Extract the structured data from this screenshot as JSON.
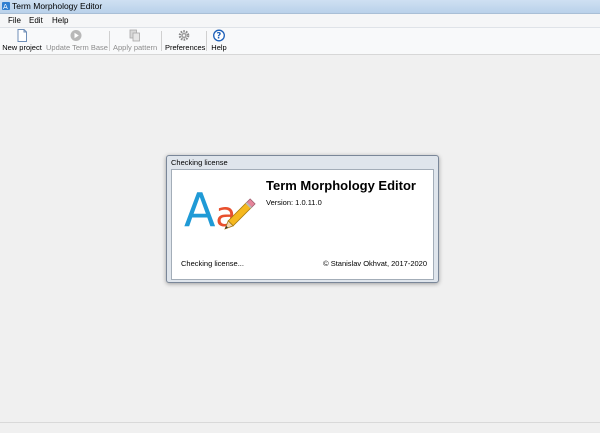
{
  "window": {
    "title": "Term Morphology Editor"
  },
  "menu": {
    "items": [
      "File",
      "Edit",
      "Help"
    ]
  },
  "toolbar": {
    "new_project": "New project",
    "update_term_base": "Update Term Base",
    "apply_pattern": "Apply pattern",
    "preferences": "Preferences",
    "help": "Help"
  },
  "dialog": {
    "title": "Checking license",
    "logo_letters": "Aa",
    "product_name": "Term Morphology Editor",
    "version": "Version: 1.0.11.0",
    "status": "Checking license...",
    "copyright": "© Stanislav Okhvat, 2017-2020"
  },
  "colors": {
    "logo_A": "#1f9ad6",
    "logo_a": "#e8502e",
    "accent": "#1c5fb8"
  }
}
